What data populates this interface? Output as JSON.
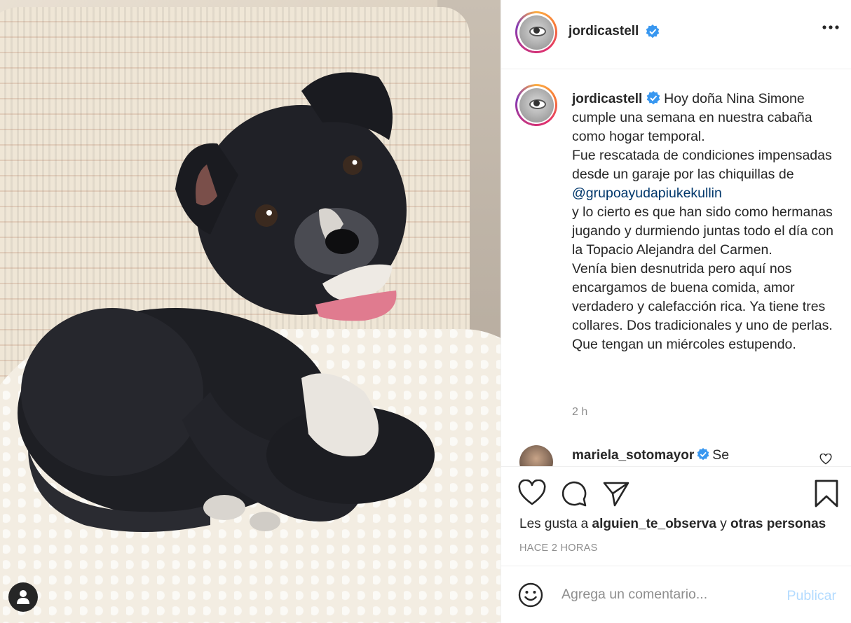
{
  "post": {
    "image_alt": "",
    "header": {
      "username": "jordicastell",
      "more_icon": "more-horizontal-icon"
    },
    "caption": {
      "username": "jordicastell",
      "text_before_mention": "Hoy doña Nina Simone cumple una semana en nuestra cabaña como hogar temporal.\nFue rescatada de condiciones impensadas desde un garaje por las chiquillas de ",
      "mention": "@grupoayudapiukekullin",
      "text_after_mention": "\ny lo cierto es que han sido como hermanas jugando y durmiendo juntas todo el día con la Topacio Alejandra del Carmen.\nVenía bien desnutrida pero aquí nos encargamos de buena comida, amor verdadero y calefacción rica. Ya tiene tres collares. Dos tradicionales y uno de perlas.\nQue tengan un miércoles estupendo.",
      "time": "2 h"
    },
    "comment": {
      "username": "mariela_sotomayor",
      "text": "Se"
    },
    "actions": {
      "like_icon": "heart-icon",
      "comment_icon": "comment-icon",
      "share_icon": "share-icon",
      "save_icon": "bookmark-icon"
    },
    "likes": {
      "prefix": "Les gusta a ",
      "liker": "alguien_te_observa",
      "middle": " y ",
      "others": "otras personas"
    },
    "posted_ago": "HACE 2 HORAS",
    "add_comment": {
      "placeholder": "Agrega un comentario...",
      "publish_label": "Publicar"
    }
  },
  "colors": {
    "verified": "#3897f0",
    "mention": "#00376b",
    "publish_disabled": "#b3dbff",
    "muted": "#8e8e8e"
  }
}
